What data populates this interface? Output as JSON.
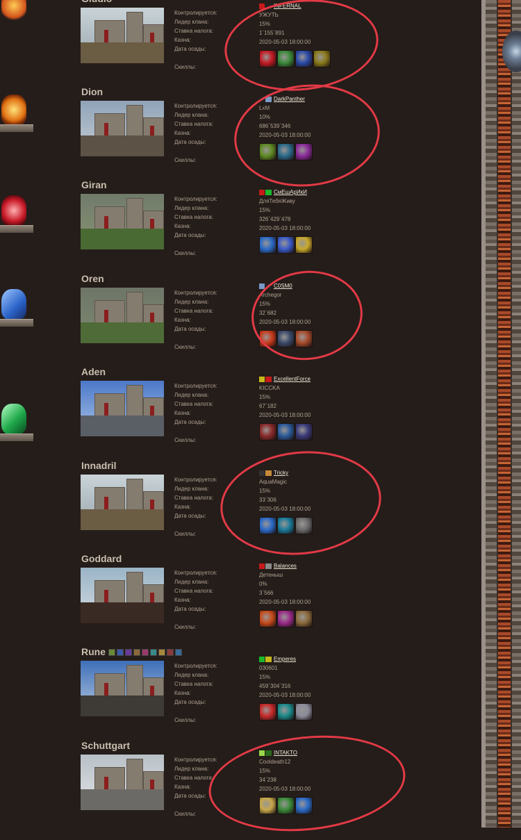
{
  "labels": {
    "controlled_by": "Контролируется:",
    "clan_leader": "Лидер клана:",
    "tax_rate": "Ставка налога:",
    "treasury": "Казна:",
    "siege_date": "Дата осады:",
    "skills": "Скиллы:"
  },
  "castles": [
    {
      "name": "Gludio",
      "clan": "INFERNAL",
      "leader": "УЖУТЬ",
      "tax": "15%",
      "treasury": "1`155`891",
      "siege": "2020-05-03 18:00:00",
      "marked": true
    },
    {
      "name": "Dion",
      "clan": "DarkPanther",
      "leader": "LxM",
      "tax": "10%",
      "treasury": "686`539`346",
      "siege": "2020-05-03 18:00:00",
      "marked": true
    },
    {
      "name": "Giran",
      "clan": "СмЕшАрИкИ",
      "leader": "ДляТебяЖиву",
      "tax": "15%",
      "treasury": "326`429`478",
      "siege": "2020-05-03 18:00:00",
      "marked": false
    },
    {
      "name": "Oren",
      "clan": "C0SM0",
      "leader": "Archegor",
      "tax": "15%",
      "treasury": "32`682",
      "siege": "2020-05-03 18:00:00",
      "marked": true
    },
    {
      "name": "Aden",
      "clan": "ExcellentForce",
      "leader": "KICCKA",
      "tax": "15%",
      "treasury": "67`182",
      "siege": "2020-05-03 18:00:00",
      "marked": false
    },
    {
      "name": "Innadril",
      "clan": "Tricky",
      "leader": "AquaMagic",
      "tax": "15%",
      "treasury": "33`306",
      "siege": "2020-05-03 18:00:00",
      "marked": true
    },
    {
      "name": "Goddard",
      "clan": "Balances",
      "leader": "Детеныш",
      "tax": "0%",
      "treasury": "3`566",
      "siege": "2020-05-03 18:00:00",
      "marked": false
    },
    {
      "name": "Rune",
      "clan": "Emperes",
      "leader": "030601",
      "tax": "15%",
      "treasury": "459`304`316",
      "siege": "2020-05-03 18:00:00",
      "marked": false
    },
    {
      "name": "Schuttgart",
      "clan": "INTAKTO",
      "leader": "Cooldeath12",
      "tax": "15%",
      "treasury": "34`238",
      "siege": "2020-05-03 18:00:00",
      "marked": true
    }
  ],
  "colors": {
    "background": "#241d1a",
    "link": "#f0e6d6",
    "annotation": "#e23a45"
  }
}
